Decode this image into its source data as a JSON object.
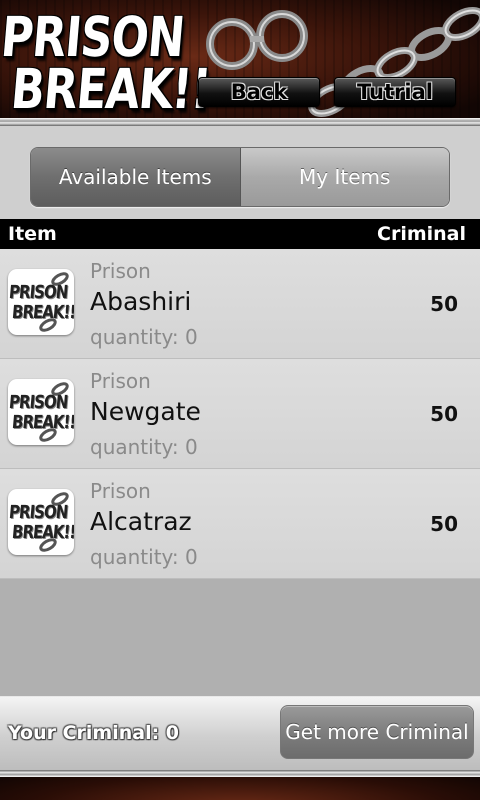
{
  "header": {
    "logo_line1": "PRISON",
    "logo_line2": "BREAK!!",
    "back_label": "Back",
    "tutorial_label": "Tutrial"
  },
  "tabs": [
    {
      "label": "Available Items",
      "active": true
    },
    {
      "label": "My Items",
      "active": false
    }
  ],
  "columns": {
    "item": "Item",
    "criminal": "Criminal"
  },
  "items": [
    {
      "category": "Prison",
      "name": "Abashiri",
      "quantity": "quantity: 0",
      "price": "50"
    },
    {
      "category": "Prison",
      "name": "Newgate",
      "quantity": "quantity: 0",
      "price": "50"
    },
    {
      "category": "Prison",
      "name": "Alcatraz",
      "quantity": "quantity: 0",
      "price": "50"
    }
  ],
  "thumb": {
    "line1": "PRISON",
    "line2": "BREAK!!"
  },
  "footer": {
    "your_criminal": "Your Criminal: 0",
    "get_more_label": "Get more Criminal"
  },
  "colors": {
    "header_bg": "#3a140a",
    "tab_active": "#6f6f6f",
    "column_header_bg": "#000000",
    "row_bg": "#d8d8d8",
    "empty_bg": "#b0b0b0"
  }
}
